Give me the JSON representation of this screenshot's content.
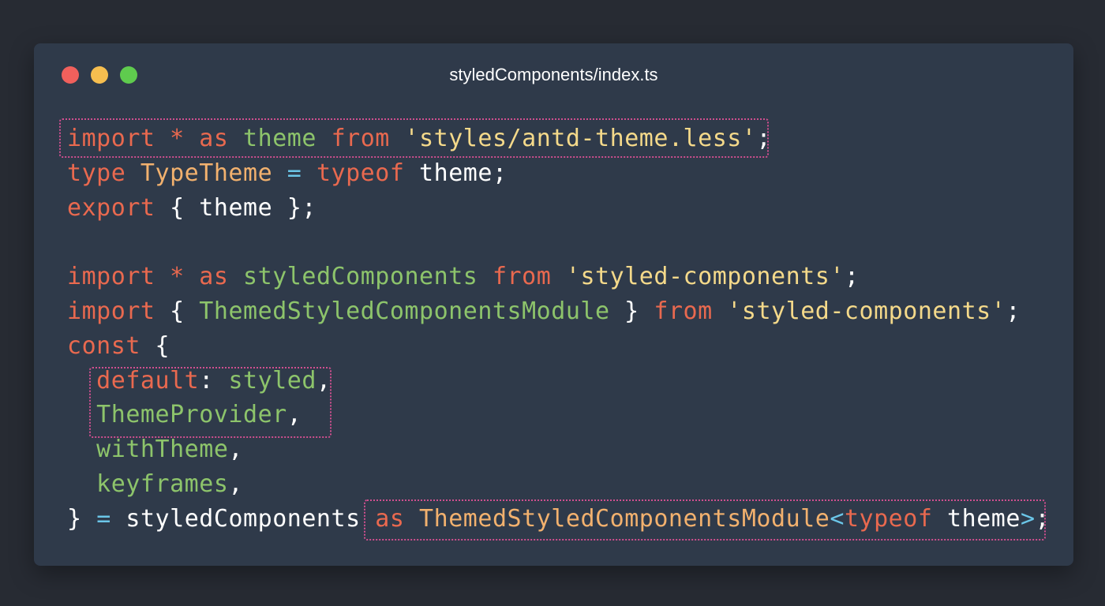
{
  "window": {
    "title": "styledComponents/index.ts",
    "colors": {
      "background": "#272b33",
      "window_background": "#2f3a4a",
      "keyword": "#e9694f",
      "identifier": "#8dc46b",
      "type": "#f2b16e",
      "string": "#f4d98a",
      "operator": "#6bc6e8",
      "plain": "#ffffff",
      "highlight_border": "#d04f8f"
    }
  },
  "code": {
    "lines": [
      [
        {
          "t": "import",
          "c": "kw"
        },
        {
          "t": " "
        },
        {
          "t": "*",
          "c": "kw"
        },
        {
          "t": " "
        },
        {
          "t": "as",
          "c": "kw"
        },
        {
          "t": " "
        },
        {
          "t": "theme",
          "c": "id"
        },
        {
          "t": " "
        },
        {
          "t": "from",
          "c": "kw"
        },
        {
          "t": " "
        },
        {
          "t": "'styles/antd-theme.less'",
          "c": "str"
        },
        {
          "t": ";",
          "c": "pl"
        }
      ],
      [
        {
          "t": "type",
          "c": "kw"
        },
        {
          "t": " "
        },
        {
          "t": "TypeTheme",
          "c": "ty"
        },
        {
          "t": " "
        },
        {
          "t": "=",
          "c": "op"
        },
        {
          "t": " "
        },
        {
          "t": "typeof",
          "c": "kw"
        },
        {
          "t": " "
        },
        {
          "t": "theme",
          "c": "pl"
        },
        {
          "t": ";",
          "c": "pl"
        }
      ],
      [
        {
          "t": "export",
          "c": "kw"
        },
        {
          "t": " "
        },
        {
          "t": "{",
          "c": "pl"
        },
        {
          "t": " "
        },
        {
          "t": "theme",
          "c": "pl"
        },
        {
          "t": " "
        },
        {
          "t": "};",
          "c": "pl"
        }
      ],
      [],
      [
        {
          "t": "import",
          "c": "kw"
        },
        {
          "t": " "
        },
        {
          "t": "*",
          "c": "kw"
        },
        {
          "t": " "
        },
        {
          "t": "as",
          "c": "kw"
        },
        {
          "t": " "
        },
        {
          "t": "styledComponents",
          "c": "id"
        },
        {
          "t": " "
        },
        {
          "t": "from",
          "c": "kw"
        },
        {
          "t": " "
        },
        {
          "t": "'styled-components'",
          "c": "str"
        },
        {
          "t": ";",
          "c": "pl"
        }
      ],
      [
        {
          "t": "import",
          "c": "kw"
        },
        {
          "t": " "
        },
        {
          "t": "{",
          "c": "pl"
        },
        {
          "t": " "
        },
        {
          "t": "ThemedStyledComponentsModule",
          "c": "id"
        },
        {
          "t": " "
        },
        {
          "t": "}",
          "c": "pl"
        },
        {
          "t": " "
        },
        {
          "t": "from",
          "c": "kw"
        },
        {
          "t": " "
        },
        {
          "t": "'styled-components'",
          "c": "str"
        },
        {
          "t": ";",
          "c": "pl"
        }
      ],
      [
        {
          "t": "const",
          "c": "kw"
        },
        {
          "t": " "
        },
        {
          "t": "{",
          "c": "pl"
        }
      ],
      [
        {
          "t": "  "
        },
        {
          "t": "default",
          "c": "kw"
        },
        {
          "t": ":",
          "c": "pl"
        },
        {
          "t": " "
        },
        {
          "t": "styled",
          "c": "id"
        },
        {
          "t": ",",
          "c": "pl"
        }
      ],
      [
        {
          "t": "  "
        },
        {
          "t": "ThemeProvider",
          "c": "id"
        },
        {
          "t": ",",
          "c": "pl"
        }
      ],
      [
        {
          "t": "  "
        },
        {
          "t": "withTheme",
          "c": "id"
        },
        {
          "t": ",",
          "c": "pl"
        }
      ],
      [
        {
          "t": "  "
        },
        {
          "t": "keyframes",
          "c": "id"
        },
        {
          "t": ",",
          "c": "pl"
        }
      ],
      [
        {
          "t": "}",
          "c": "pl"
        },
        {
          "t": " "
        },
        {
          "t": "=",
          "c": "op"
        },
        {
          "t": " "
        },
        {
          "t": "styledComponents",
          "c": "pl"
        },
        {
          "t": " "
        },
        {
          "t": "as",
          "c": "kw"
        },
        {
          "t": " "
        },
        {
          "t": "ThemedStyledComponentsModule",
          "c": "ty"
        },
        {
          "t": "<",
          "c": "op"
        },
        {
          "t": "typeof",
          "c": "kw"
        },
        {
          "t": " "
        },
        {
          "t": "theme",
          "c": "pl"
        },
        {
          "t": ">",
          "c": "op"
        },
        {
          "t": ";",
          "c": "pl"
        }
      ]
    ]
  }
}
